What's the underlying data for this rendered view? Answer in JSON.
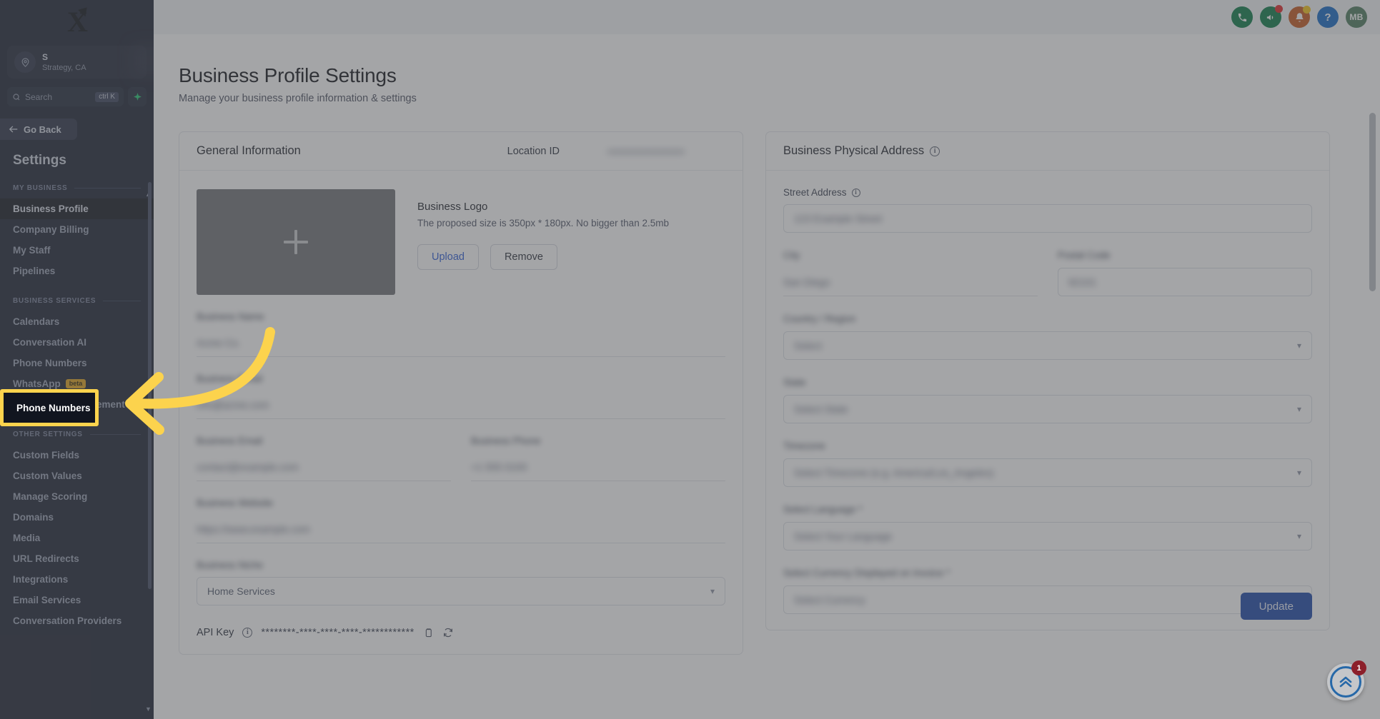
{
  "sidebar": {
    "logo_letter": "X",
    "location": {
      "name": "S",
      "subtitle": "Strategy, CA"
    },
    "search": {
      "placeholder": "Search",
      "shortcut": "ctrl K",
      "spark_icon": "sparkle-icon"
    },
    "go_back": "Go Back",
    "title": "Settings",
    "sections": [
      {
        "label": "MY BUSINESS",
        "items": [
          {
            "label": "Business Profile",
            "active": true
          },
          {
            "label": "Company Billing",
            "active": false
          },
          {
            "label": "My Staff",
            "active": false
          },
          {
            "label": "Pipelines",
            "active": false
          }
        ]
      },
      {
        "label": "BUSINESS SERVICES",
        "items": [
          {
            "label": "Calendars",
            "active": false
          },
          {
            "label": "Conversation AI",
            "active": false
          },
          {
            "label": "Phone Numbers",
            "active": false
          },
          {
            "label": "WhatsApp",
            "badge": "beta",
            "active": false
          },
          {
            "label": "Reputation Management",
            "active": false
          }
        ]
      },
      {
        "label": "OTHER SETTINGS",
        "items": [
          {
            "label": "Custom Fields",
            "active": false
          },
          {
            "label": "Custom Values",
            "active": false
          },
          {
            "label": "Manage Scoring",
            "active": false
          },
          {
            "label": "Domains",
            "active": false
          },
          {
            "label": "Media",
            "active": false
          },
          {
            "label": "URL Redirects",
            "active": false
          },
          {
            "label": "Integrations",
            "active": false
          },
          {
            "label": "Email Services",
            "active": false
          },
          {
            "label": "Conversation Providers",
            "active": false
          }
        ]
      }
    ]
  },
  "topbar": {
    "icons": [
      {
        "name": "phone-icon",
        "glyph": "✆",
        "color": "#0a7a46"
      },
      {
        "name": "megaphone-icon",
        "glyph": "⚑",
        "color": "#0a7a46",
        "badge": "red"
      },
      {
        "name": "bell-icon",
        "glyph": "☀",
        "color": "#c4561c",
        "badge": "yellow"
      },
      {
        "name": "help-icon",
        "glyph": "?",
        "color": "#1266c4"
      }
    ],
    "avatar_initials": "MB"
  },
  "page": {
    "title": "Business Profile Settings",
    "subtitle": "Manage your business profile information & settings"
  },
  "general_information": {
    "card_title": "General Information",
    "location_id_label": "Location ID",
    "location_id_value": "••••••••••••••••••••••",
    "logo": {
      "title": "Business Logo",
      "hint": "The proposed size is 350px * 180px. No bigger than 2.5mb",
      "placeholder_icon": "plus-icon",
      "upload_label": "Upload",
      "remove_label": "Remove"
    },
    "fields": [
      {
        "label": "Business Name",
        "value": "Acme Co.",
        "blurred": true
      },
      {
        "label": "Business Email",
        "value": "info@acme.com",
        "blurred": true
      },
      {
        "label": "Business Phone",
        "value": "",
        "blurred": true
      }
    ],
    "two_col": {
      "left": {
        "label": "Business Email",
        "value": "contact@example.com"
      },
      "right": {
        "label": "Business Phone",
        "value": "+1 555 0100"
      }
    },
    "website": {
      "label": "Business Website",
      "value": "https://www.example.com"
    },
    "niche": {
      "label": "Business Niche",
      "value": "Home Services"
    },
    "api_key": {
      "label": "API Key",
      "info_icon": "info-icon",
      "mask": "********-****-****-****-************",
      "copy_icon": "copy-icon",
      "refresh_icon": "refresh-icon"
    }
  },
  "physical_address": {
    "card_title": "Business Physical Address",
    "info_icon": "info-icon",
    "street": {
      "label": "Street Address",
      "value": "123 Example Street"
    },
    "city": {
      "label": "City",
      "value": "San Diego"
    },
    "postal": {
      "label": "Postal Code",
      "value": "92101"
    },
    "country": {
      "label": "Country / Region",
      "value": "Select"
    },
    "state": {
      "label": "State",
      "value": "Select State"
    },
    "timezone": {
      "label": "Timezone",
      "value": "Select Timezone (e.g. America/Los_Angeles)"
    },
    "language": {
      "label": "Select Language *",
      "value": "Select Your Language"
    },
    "currency": {
      "label": "Select Currency Displayed on Invoice *",
      "value": "Select Currency"
    },
    "update_label": "Update"
  },
  "annotation": {
    "highlight_label": "Phone Numbers",
    "arrow_icon": "curved-arrow-icon",
    "arrow_color": "#fcd34d"
  },
  "float_widget": {
    "icon": "chevrons-up-icon",
    "badge_count": "1"
  }
}
